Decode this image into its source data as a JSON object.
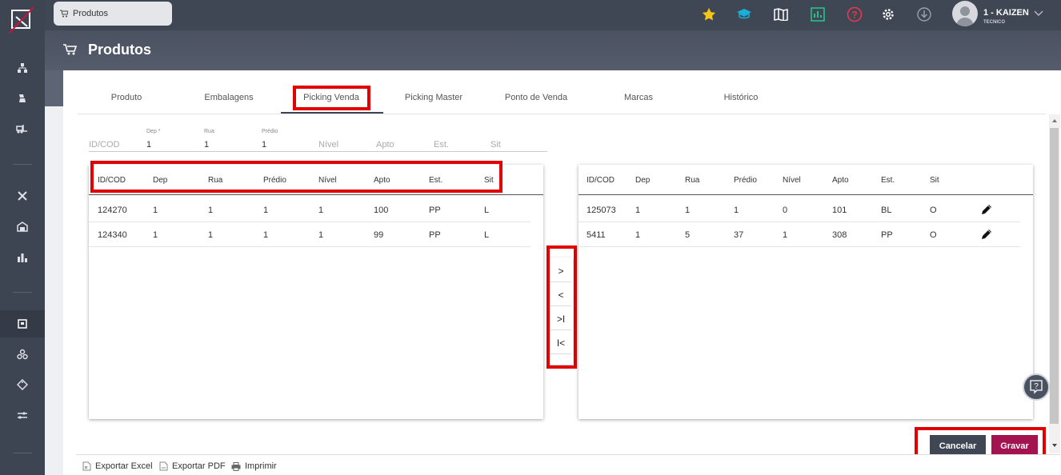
{
  "app": {
    "open_tab": "Produtos",
    "page_title": "Produtos",
    "user": {
      "name": "1 - KAIZEN",
      "role": "TECNICO"
    }
  },
  "tabs": [
    "Produto",
    "Embalagens",
    "Picking Venda",
    "Picking Master",
    "Ponto de Venda",
    "Marcas",
    "Histórico"
  ],
  "active_tab": "Picking Venda",
  "filter": {
    "idcod_placeholder": "ID/COD",
    "dep_label": "Dep *",
    "dep_value": "1",
    "rua_label": "Rua",
    "rua_value": "1",
    "predio_label": "Prédio",
    "predio_value": "1",
    "nivel_placeholder": "Nível",
    "apto_placeholder": "Apto",
    "est_placeholder": "Est.",
    "sit_placeholder": "Sit"
  },
  "left_table": {
    "columns": [
      "ID/COD",
      "Dep",
      "Rua",
      "Prédio",
      "Nível",
      "Apto",
      "Est.",
      "Sit"
    ],
    "rows": [
      [
        "124270",
        "1",
        "1",
        "1",
        "1",
        "100",
        "PP",
        "L"
      ],
      [
        "124340",
        "1",
        "1",
        "1",
        "1",
        "99",
        "PP",
        "L"
      ]
    ]
  },
  "right_table": {
    "columns": [
      "ID/COD",
      "Dep",
      "Rua",
      "Prédio",
      "Nível",
      "Apto",
      "Est.",
      "Sit"
    ],
    "rows": [
      [
        "125073",
        "1",
        "1",
        "1",
        "0",
        "101",
        "BL",
        "O"
      ],
      [
        "5411",
        "1",
        "5",
        "37",
        "1",
        "308",
        "PP",
        "O"
      ]
    ]
  },
  "transfer_buttons": [
    ">",
    "<",
    ">I",
    "I<"
  ],
  "actions": {
    "cancel": "Cancelar",
    "save": "Gravar"
  },
  "footer": {
    "export_excel": "Exportar Excel",
    "export_pdf": "Exportar PDF",
    "print": "Imprimir"
  },
  "colors": {
    "sidebar": "#3d4452",
    "cancel_button": "#3f4654",
    "save_button": "#a3134f",
    "highlight": "#e00000"
  },
  "top_icons": [
    "star-icon",
    "graduation-cap-icon",
    "map-icon",
    "chart-icon",
    "help-circle-icon",
    "gear-icon",
    "download-icon"
  ]
}
